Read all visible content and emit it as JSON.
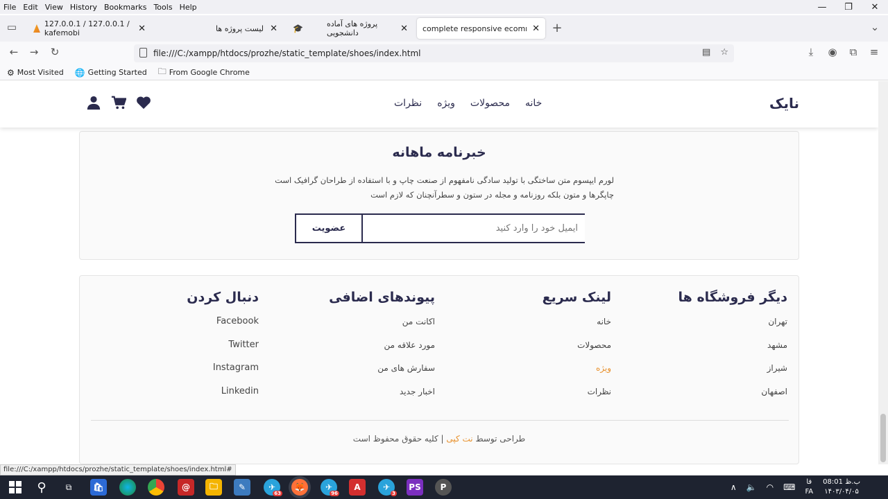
{
  "menubar": {
    "items": [
      "File",
      "Edit",
      "View",
      "History",
      "Bookmarks",
      "Tools",
      "Help"
    ]
  },
  "window_controls": {
    "minimize": "—",
    "restore": "❐",
    "close": "✕"
  },
  "tabs": [
    {
      "label": "127.0.0.1 / 127.0.0.1 / kafemobi",
      "icon": "phpmyadmin-icon"
    },
    {
      "label": "لیست پروژه ها",
      "icon": ""
    },
    {
      "label": "پروژه های آماده دانشجویی",
      "icon": "graduation-cap-icon"
    },
    {
      "label": "complete responsive ecommerce w",
      "icon": "",
      "active": true
    }
  ],
  "navbar": {
    "url": "file:///C:/xampp/htdocs/prozhe/static_template/shoes/index.html"
  },
  "bookmarks": [
    {
      "label": "Most Visited",
      "icon": "gear-icon"
    },
    {
      "label": "Getting Started",
      "icon": "globe-icon"
    },
    {
      "label": "From Google Chrome",
      "icon": "folder-icon"
    }
  ],
  "site": {
    "logo": "نایک",
    "nav": [
      "خانه",
      "محصولات",
      "ویژه",
      "نظرات"
    ]
  },
  "newsletter": {
    "title": "خبرنامه ماهانه",
    "text_line1": "لورم ایپسوم متن ساختگی با تولید سادگی نامفهوم از صنعت چاپ و با استفاده از طراحان گرافیک است",
    "text_line2": "چاپگرها و متون بلکه روزنامه و مجله در ستون و سطرآنچنان که لازم است",
    "placeholder": "ایمیل خود را وارد کنید",
    "button": "عضویت"
  },
  "footer": {
    "columns": [
      {
        "title": "دیگر فروشگاه ها",
        "links": [
          "تهران",
          "مشهد",
          "شیراز",
          "اصفهان"
        ]
      },
      {
        "title": "لینک سریع",
        "links": [
          "خانه",
          "محصولات",
          "ویژه",
          "نظرات"
        ]
      },
      {
        "title": "پیوندهای اضافی",
        "links": [
          "اکانت من",
          "مورد علاقه من",
          "سفارش های من",
          "اخبار جدید"
        ]
      },
      {
        "title": "دنبال کردن",
        "links": [
          "Facebook",
          "Twitter",
          "Instagram",
          "Linkedin"
        ]
      }
    ],
    "credit_prefix": "طراحی توسط",
    "credit_brand": "نت کپی",
    "credit_suffix": "| کلیه حقوق محفوظ است"
  },
  "status_url": "file:///C:/xampp/htdocs/prozhe/static_template/shoes/index.html#",
  "taskbar": {
    "badges": {
      "telegram1": "63",
      "telegram2": "96",
      "telegram3": "3"
    },
    "lang": "FA",
    "lang_short": "فا",
    "time": "ب.ظ 08:01",
    "date": "۱۴۰۳/۰۴/۰۵"
  },
  "colors": {
    "brand": "#2b2b4e",
    "accent": "#e8902b"
  }
}
